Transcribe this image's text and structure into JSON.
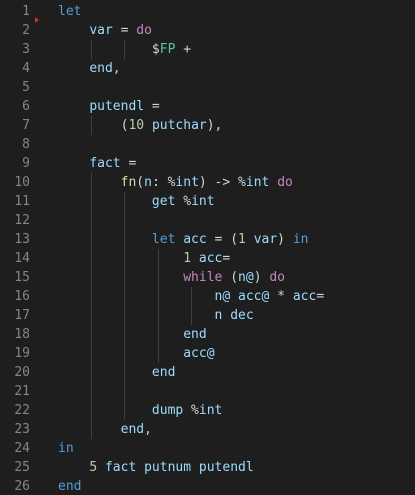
{
  "editor": {
    "colors": {
      "background": "#1e1e1e",
      "line_number": "#858585",
      "keyword": "#569cd6",
      "control": "#c586c0",
      "number": "#b5cea8",
      "function": "#dcdcaa",
      "identifier": "#9cdcfe",
      "type": "#4ec9b0",
      "plain": "#d4d4d4"
    },
    "lines": [
      {
        "n": "1",
        "tokens": [
          {
            "t": "let",
            "c": "kw"
          }
        ]
      },
      {
        "n": "2",
        "tokens": [
          {
            "t": "    "
          },
          {
            "t": "var",
            "c": "id"
          },
          {
            "t": " = ",
            "c": "pl"
          },
          {
            "t": "do",
            "c": "ctl"
          }
        ]
      },
      {
        "n": "3",
        "tokens": [
          {
            "t": "            "
          },
          {
            "t": "$",
            "c": "pl"
          },
          {
            "t": "FP",
            "c": "ty"
          },
          {
            "t": " +",
            "c": "pl"
          }
        ]
      },
      {
        "n": "4",
        "tokens": [
          {
            "t": "    "
          },
          {
            "t": "end,",
            "c": "id"
          }
        ]
      },
      {
        "n": "5",
        "tokens": []
      },
      {
        "n": "6",
        "tokens": [
          {
            "t": "    "
          },
          {
            "t": "putendl",
            "c": "id"
          },
          {
            "t": " =",
            "c": "pl"
          }
        ]
      },
      {
        "n": "7",
        "tokens": [
          {
            "t": "        "
          },
          {
            "t": "(",
            "c": "pl"
          },
          {
            "t": "10",
            "c": "num"
          },
          {
            "t": " ",
            "c": "pl"
          },
          {
            "t": "putchar",
            "c": "id"
          },
          {
            "t": "),",
            "c": "pl"
          }
        ]
      },
      {
        "n": "8",
        "tokens": []
      },
      {
        "n": "9",
        "tokens": [
          {
            "t": "    "
          },
          {
            "t": "fact",
            "c": "id"
          },
          {
            "t": " =",
            "c": "pl"
          }
        ]
      },
      {
        "n": "10",
        "tokens": [
          {
            "t": "        "
          },
          {
            "t": "fn",
            "c": "fn"
          },
          {
            "t": "(",
            "c": "pl"
          },
          {
            "t": "n",
            "c": "id"
          },
          {
            "t": ": %",
            "c": "pl"
          },
          {
            "t": "int",
            "c": "id"
          },
          {
            "t": ") -> %",
            "c": "pl"
          },
          {
            "t": "int",
            "c": "id"
          },
          {
            "t": " ",
            "c": "pl"
          },
          {
            "t": "do",
            "c": "ctl"
          }
        ]
      },
      {
        "n": "11",
        "tokens": [
          {
            "t": "            "
          },
          {
            "t": "get",
            "c": "id"
          },
          {
            "t": " %",
            "c": "pl"
          },
          {
            "t": "int",
            "c": "id"
          }
        ]
      },
      {
        "n": "12",
        "tokens": []
      },
      {
        "n": "13",
        "tokens": [
          {
            "t": "            "
          },
          {
            "t": "let",
            "c": "kw"
          },
          {
            "t": " ",
            "c": "pl"
          },
          {
            "t": "acc",
            "c": "id"
          },
          {
            "t": " = (",
            "c": "pl"
          },
          {
            "t": "1",
            "c": "num"
          },
          {
            "t": " ",
            "c": "pl"
          },
          {
            "t": "var",
            "c": "id"
          },
          {
            "t": ") ",
            "c": "pl"
          },
          {
            "t": "in",
            "c": "kw"
          }
        ]
      },
      {
        "n": "14",
        "tokens": [
          {
            "t": "                "
          },
          {
            "t": "1",
            "c": "num"
          },
          {
            "t": " ",
            "c": "pl"
          },
          {
            "t": "acc",
            "c": "id"
          },
          {
            "t": "=",
            "c": "pl"
          }
        ]
      },
      {
        "n": "15",
        "tokens": [
          {
            "t": "                "
          },
          {
            "t": "while",
            "c": "ctl"
          },
          {
            "t": " (",
            "c": "pl"
          },
          {
            "t": "n@",
            "c": "id"
          },
          {
            "t": ") ",
            "c": "pl"
          },
          {
            "t": "do",
            "c": "ctl"
          }
        ]
      },
      {
        "n": "16",
        "tokens": [
          {
            "t": "                    "
          },
          {
            "t": "n@",
            "c": "id"
          },
          {
            "t": " ",
            "c": "pl"
          },
          {
            "t": "acc@",
            "c": "id"
          },
          {
            "t": " * ",
            "c": "pl"
          },
          {
            "t": "acc",
            "c": "id"
          },
          {
            "t": "=",
            "c": "pl"
          }
        ]
      },
      {
        "n": "17",
        "tokens": [
          {
            "t": "                    "
          },
          {
            "t": "n",
            "c": "id"
          },
          {
            "t": " ",
            "c": "pl"
          },
          {
            "t": "dec",
            "c": "id"
          }
        ]
      },
      {
        "n": "18",
        "tokens": [
          {
            "t": "                "
          },
          {
            "t": "end",
            "c": "id"
          }
        ]
      },
      {
        "n": "19",
        "tokens": [
          {
            "t": "                "
          },
          {
            "t": "acc@",
            "c": "id"
          }
        ]
      },
      {
        "n": "20",
        "tokens": [
          {
            "t": "            "
          },
          {
            "t": "end",
            "c": "id"
          }
        ]
      },
      {
        "n": "21",
        "tokens": []
      },
      {
        "n": "22",
        "tokens": [
          {
            "t": "            "
          },
          {
            "t": "dump",
            "c": "id"
          },
          {
            "t": " %",
            "c": "pl"
          },
          {
            "t": "int",
            "c": "id"
          }
        ]
      },
      {
        "n": "23",
        "tokens": [
          {
            "t": "        "
          },
          {
            "t": "end,",
            "c": "id"
          }
        ]
      },
      {
        "n": "24",
        "tokens": [
          {
            "t": "in",
            "c": "kw"
          }
        ]
      },
      {
        "n": "25",
        "tokens": [
          {
            "t": "    "
          },
          {
            "t": "5",
            "c": "num"
          },
          {
            "t": " ",
            "c": "pl"
          },
          {
            "t": "fact",
            "c": "id"
          },
          {
            "t": " ",
            "c": "pl"
          },
          {
            "t": "putnum",
            "c": "id"
          },
          {
            "t": " ",
            "c": "pl"
          },
          {
            "t": "putendl",
            "c": "id"
          }
        ]
      },
      {
        "n": "26",
        "tokens": [
          {
            "t": "end",
            "c": "kw"
          }
        ]
      }
    ]
  }
}
